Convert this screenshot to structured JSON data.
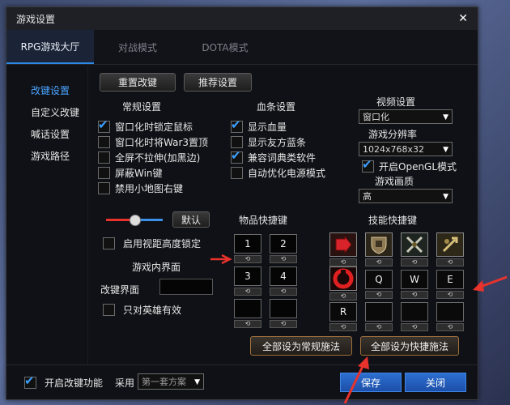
{
  "window": {
    "title": "游戏设置",
    "close_icon": "✕"
  },
  "tabs": [
    {
      "label": "RPG游戏大厅",
      "active": true
    },
    {
      "label": "对战模式",
      "active": false
    },
    {
      "label": "DOTA模式",
      "active": false
    }
  ],
  "sidebar": [
    {
      "label": "改键设置",
      "active": true
    },
    {
      "label": "自定义改键",
      "active": false
    },
    {
      "label": "喊话设置",
      "active": false
    },
    {
      "label": "游戏路径",
      "active": false
    }
  ],
  "actions": {
    "reset": "重置改键",
    "recommend": "推荐设置"
  },
  "general": {
    "title": "常规设置",
    "options": [
      {
        "label": "窗口化时锁定鼠标",
        "checked": true
      },
      {
        "label": "窗口化时将War3置顶",
        "checked": false
      },
      {
        "label": "全屏不拉伸(加黑边)",
        "checked": false
      },
      {
        "label": "屏蔽Win键",
        "checked": false
      },
      {
        "label": "禁用小地图右键",
        "checked": false
      }
    ]
  },
  "hp_bar": {
    "title": "血条设置",
    "options": [
      {
        "label": "显示血量",
        "checked": true
      },
      {
        "label": "显示友方蓝条",
        "checked": false
      },
      {
        "label": "兼容词典类软件",
        "checked": true
      },
      {
        "label": "自动优化电源模式",
        "checked": false
      }
    ]
  },
  "video": {
    "title": "视频设置",
    "mode_value": "窗口化",
    "resolution_title": "游戏分辨率",
    "resolution_value": "1024x768x32",
    "opengl_label": "开启OpenGL模式",
    "opengl_checked": true,
    "quality_title": "游戏画质",
    "quality_value": "高"
  },
  "slider": {
    "default_label": "默认",
    "level": 0.5
  },
  "lock_height": {
    "label": "启用视距高度锁定",
    "checked": false
  },
  "ingame": {
    "title": "游戏内界面",
    "change_label": "改键界面",
    "change_value": "",
    "hero_only_label": "只对英雄有效",
    "hero_only_checked": false
  },
  "item_hotkeys": {
    "title": "物品快捷键",
    "slots": [
      "1",
      "2",
      "3",
      "4",
      "",
      ""
    ]
  },
  "skill_hotkeys": {
    "title": "技能快捷键",
    "row1_icons": [
      "move-icon",
      "defend-icon",
      "attack-icon",
      "patrol-icon"
    ],
    "row2_icon": "stop-icon",
    "row2_keys": [
      "Q",
      "W",
      "E"
    ],
    "row3_keys": [
      "R",
      "",
      "",
      ""
    ]
  },
  "set_buttons": {
    "normal": "全部设为常规施法",
    "quick": "全部设为快捷施法"
  },
  "bottom": {
    "enable_label": "开启改键功能",
    "enable_checked": true,
    "use_label": "采用",
    "scheme_value": "第一套方案",
    "save": "保存",
    "close": "关闭"
  },
  "colors": {
    "accent": "#2c8ae6",
    "arrow": "#e8322c",
    "check": "#3ba0ff"
  }
}
